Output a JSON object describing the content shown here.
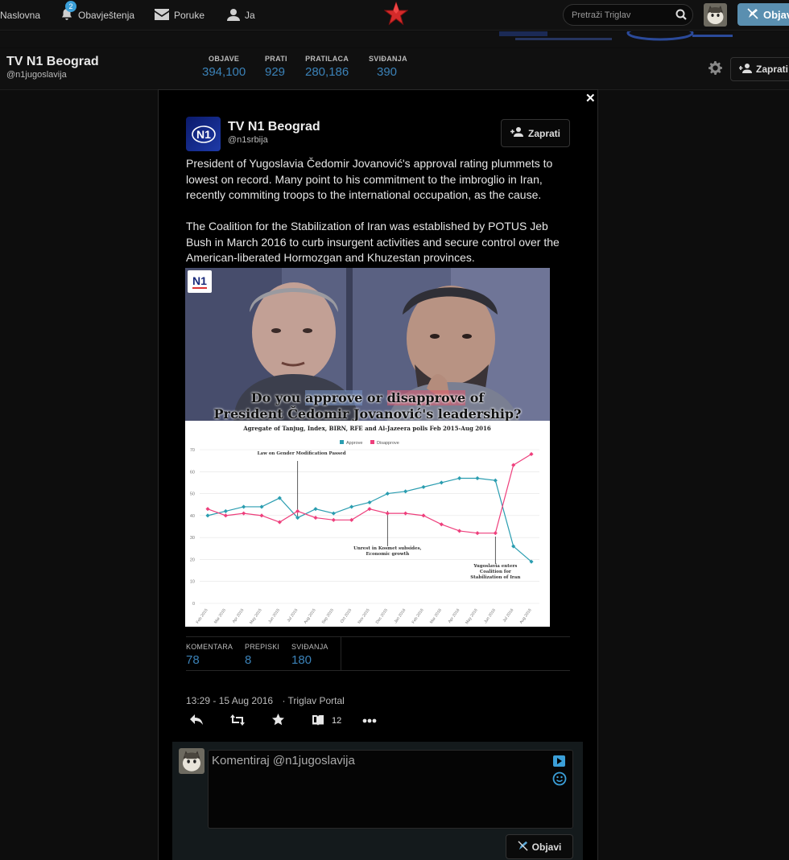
{
  "nav": {
    "home": "Naslovna",
    "notifications": "Obavještenja",
    "notifications_count": "2",
    "messages": "Poruke",
    "me": "Ja",
    "search_placeholder": "Pretraži Triglav",
    "post_button": "Objavi"
  },
  "profile": {
    "name": "TV N1 Beograd",
    "handle": "@n1jugoslavija",
    "stats": [
      {
        "label": "OBJAVE",
        "value": "394,100"
      },
      {
        "label": "PRATI",
        "value": "929"
      },
      {
        "label": "PRATILACA",
        "value": "280,186"
      },
      {
        "label": "SVIĐANJA",
        "value": "390"
      }
    ],
    "follow_label": "Zaprati"
  },
  "tweet": {
    "author_name": "TV N1 Beograd",
    "author_handle": "@n1srbija",
    "avatar_text": "N1",
    "follow_label": "Zaprati",
    "paragraph1": "President of Yugoslavia Čedomir Jovanović's approval rating plummets to lowest on record. Many point to his commitment to the imbroglio in Iran, recently commiting troops to the international occupation, as the cause.",
    "paragraph2": "The Coalition for the Stabilization of Iran was established by POTUS Jeb Bush in March 2016 to curb insurgent activities and secure control over the American-liberated Hormozgan and Khuzestan provinces.",
    "media": {
      "badge": "N1",
      "title_part1": "Do you ",
      "title_approve": "approve",
      "title_part2": " or ",
      "title_disapprove": "disapprove",
      "title_part3": " of",
      "title_line2": "President Čedomir Jovanović's leadership?"
    },
    "counts": [
      {
        "label": "KOMENTARA",
        "value": "78"
      },
      {
        "label": "PREPISKI",
        "value": "8"
      },
      {
        "label": "SVIĐANJA",
        "value": "180"
      }
    ],
    "timestamp": "13:29 - 15 Aug 2016",
    "source": "· Triglav Portal",
    "bookmark_count": "12"
  },
  "reply": {
    "placeholder": "Komentiraj @n1jugoslavija",
    "submit_label": "Objavi"
  },
  "chart_data": {
    "type": "line",
    "title": "Agregate of Tanjug, Index, BIRN, RFE and Al-Jazeera polls Feb 2015-Aug 2016",
    "categories": [
      "Feb 2015",
      "Mar 2015",
      "Apr 2015",
      "May 2015",
      "Jun 2015",
      "Jul 2015",
      "Aug 2015",
      "Sep 2015",
      "Oct 2015",
      "Nov 2015",
      "Dec 2015",
      "Jan 2016",
      "Feb 2016",
      "Mar 2016",
      "Apr 2016",
      "May 2016",
      "Jun 2016",
      "Jul 2016",
      "Aug 2016"
    ],
    "series": [
      {
        "name": "Approve",
        "color": "#2a9db0",
        "values": [
          40,
          42,
          44,
          44,
          48,
          39,
          43,
          41,
          44,
          46,
          50,
          51,
          53,
          55,
          57,
          57,
          56,
          26,
          19
        ]
      },
      {
        "name": "Disapprove",
        "color": "#ee3f7c",
        "values": [
          43,
          40,
          41,
          40,
          37,
          42,
          39,
          38,
          38,
          43,
          41,
          41,
          40,
          36,
          33,
          32,
          32,
          63,
          68
        ]
      }
    ],
    "ylim": [
      0,
      70
    ],
    "yticks": [
      0,
      10,
      20,
      30,
      40,
      50,
      60,
      70
    ],
    "grid": true,
    "legend": "top-center",
    "annotations": [
      {
        "text": "Law on Gender Modification Passed",
        "x_index": 5
      },
      {
        "text": "Unrest in Kosmet subsides, Economic growth",
        "x_index": 10
      },
      {
        "text": "Yugoslavia enters Coalition for Stabilization of Iran",
        "x_index": 16
      }
    ]
  }
}
